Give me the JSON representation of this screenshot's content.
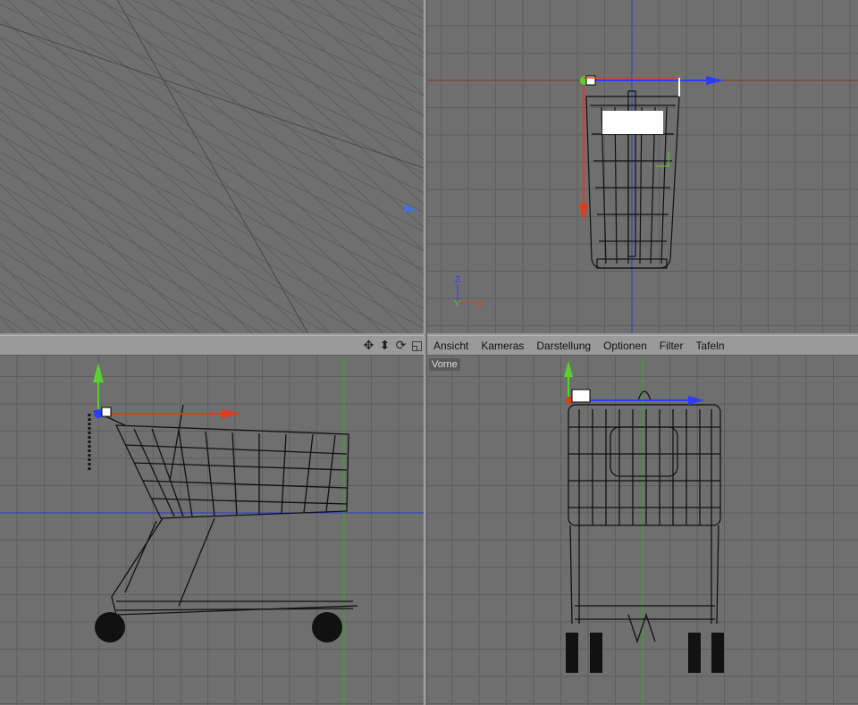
{
  "menubar": {
    "items": [
      "Ansicht",
      "Kameras",
      "Darstellung",
      "Optionen",
      "Filter",
      "Tafeln"
    ]
  },
  "nav_icons": [
    "move-icon",
    "zoom-icon",
    "rotate-icon",
    "maximize-view-icon"
  ],
  "viewports": {
    "front_label": "Vorne"
  },
  "axis_gizmo": {
    "z": "Z",
    "y": "Y",
    "x": "X"
  },
  "colors": {
    "x_axis": "#e03a1e",
    "y_axis": "#5ccf2e",
    "z_axis": "#2f3cff",
    "background": "#6f6f6f",
    "grid": "#5c5c5c"
  }
}
